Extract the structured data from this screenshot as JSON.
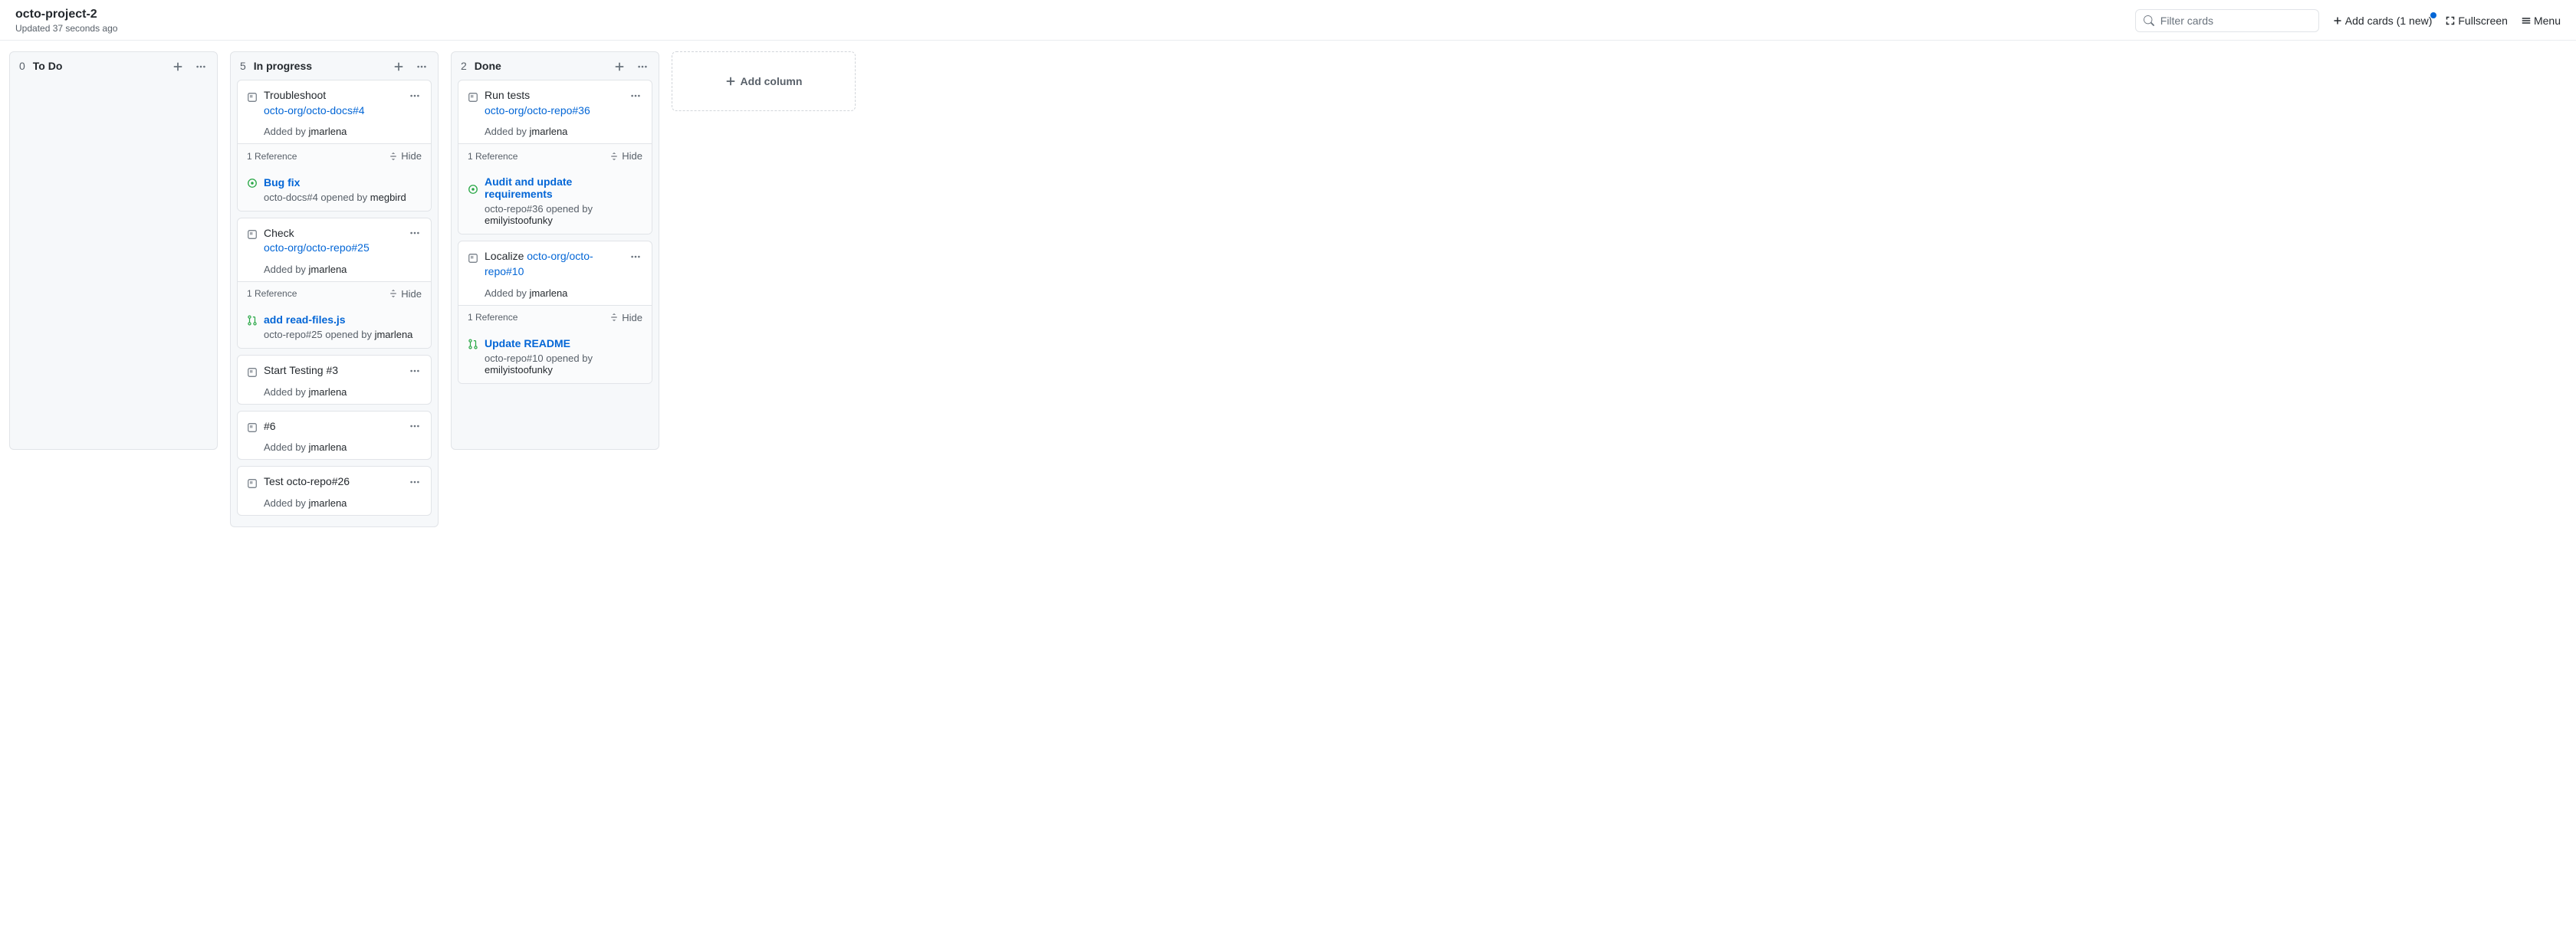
{
  "header": {
    "title": "octo-project-2",
    "updated": "Updated 37 seconds ago",
    "search_placeholder": "Filter cards",
    "add_cards_label": "Add cards (1 new)",
    "fullscreen_label": "Fullscreen",
    "menu_label": "Menu"
  },
  "add_column_label": "Add column",
  "hide_label": "Hide",
  "columns": [
    {
      "count": "0",
      "name": "To Do"
    },
    {
      "count": "5",
      "name": "In progress"
    },
    {
      "count": "2",
      "name": "Done"
    }
  ],
  "in_progress": [
    {
      "title_prefix": "Troubleshoot",
      "link": "octo-org/octo-docs#4",
      "added_by": "jmarlena",
      "ref_count": "1 Reference",
      "ref_type": "issue",
      "ref_title": "Bug fix",
      "ref_sub_prefix": "octo-docs#4 opened by ",
      "ref_sub_author": "megbird"
    },
    {
      "title_prefix": "Check",
      "link": "octo-org/octo-repo#25",
      "added_by": "jmarlena",
      "ref_count": "1 Reference",
      "ref_type": "pr",
      "ref_title": "add read-files.js",
      "ref_sub_prefix": "octo-repo#25 opened by ",
      "ref_sub_author": "jmarlena"
    },
    {
      "title_prefix": "Start Testing #3",
      "link": "",
      "added_by": "jmarlena"
    },
    {
      "title_prefix": "#6",
      "link": "",
      "added_by": "jmarlena"
    },
    {
      "title_prefix": "Test octo-repo#26",
      "link": "",
      "added_by": "jmarlena"
    }
  ],
  "done": [
    {
      "title_prefix": "Run tests",
      "link": "octo-org/octo-repo#36",
      "added_by": "jmarlena",
      "ref_count": "1 Reference",
      "ref_type": "issue",
      "ref_title": "Audit and update requirements",
      "ref_sub_prefix": "octo-repo#36 opened by ",
      "ref_sub_author": "emilyistoofunky"
    },
    {
      "title_prefix": "Localize ",
      "link": "octo-org/octo-repo#10",
      "link_inline": true,
      "added_by": "jmarlena",
      "ref_count": "1 Reference",
      "ref_type": "pr",
      "ref_title": "Update README",
      "ref_sub_prefix": "octo-repo#10 opened by ",
      "ref_sub_author": "emilyistoofunky"
    }
  ],
  "added_by_label": "Added by "
}
